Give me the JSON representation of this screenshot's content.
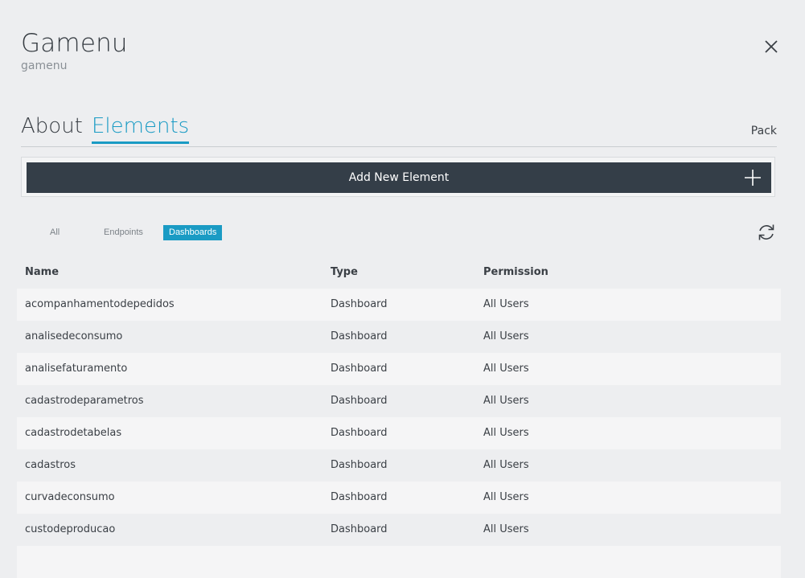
{
  "header": {
    "title": "Gamenu",
    "subtitle": "gamenu"
  },
  "tabs": {
    "about": "About",
    "elements": "Elements",
    "pack": "Pack"
  },
  "add_button": {
    "label": "Add New Element"
  },
  "filters": {
    "all": "All",
    "endpoints": "Endpoints",
    "dashboards": "Dashboards",
    "active": "Dashboards"
  },
  "colors": {
    "accent": "#1a9bc4",
    "button_dark": "#343e48",
    "background": "#edeef0"
  },
  "table": {
    "columns": {
      "name": "Name",
      "type": "Type",
      "permission": "Permission"
    },
    "rows": [
      {
        "name": "acompanhamentodepedidos",
        "type": "Dashboard",
        "permission": "All Users"
      },
      {
        "name": "analisedeconsumo",
        "type": "Dashboard",
        "permission": "All Users"
      },
      {
        "name": "analisefaturamento",
        "type": "Dashboard",
        "permission": "All Users"
      },
      {
        "name": "cadastrodeparametros",
        "type": "Dashboard",
        "permission": "All Users"
      },
      {
        "name": "cadastrodetabelas",
        "type": "Dashboard",
        "permission": "All Users"
      },
      {
        "name": "cadastros",
        "type": "Dashboard",
        "permission": "All Users"
      },
      {
        "name": "curvadeconsumo",
        "type": "Dashboard",
        "permission": "All Users"
      },
      {
        "name": "custodeproducao",
        "type": "Dashboard",
        "permission": "All Users"
      },
      {
        "name": "",
        "type": "",
        "permission": ""
      }
    ]
  }
}
